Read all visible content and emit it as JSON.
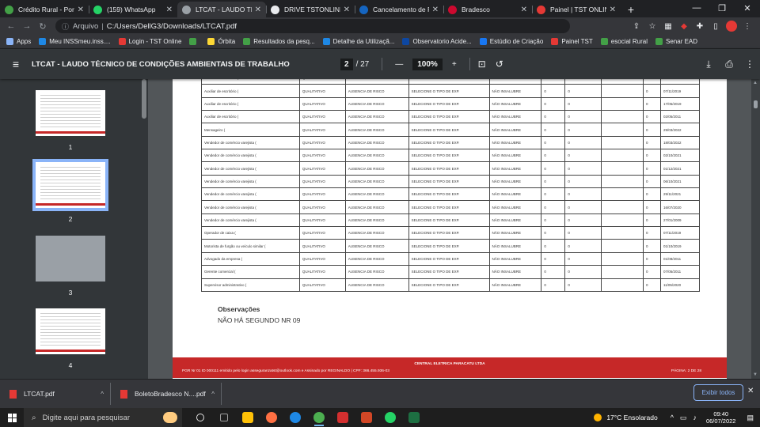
{
  "browser": {
    "tabs": [
      {
        "title": "Crédito Rural - Portal",
        "icon_color": "#43a047",
        "active": false
      },
      {
        "title": "(159) WhatsApp",
        "icon_color": "#25d366",
        "active": false
      },
      {
        "title": "LTCAT - LAUDO TÉCNICO",
        "icon_color": "#9aa0a6",
        "active": true
      },
      {
        "title": "DRIVE TSTONLINE",
        "icon_color": "#e8eaed",
        "active": false
      },
      {
        "title": "Cancelamento de Pro",
        "icon_color": "#1565c0",
        "active": false
      },
      {
        "title": "Bradesco",
        "icon_color": "#cc092f",
        "active": false
      },
      {
        "title": "Painel | TST ONLINE",
        "icon_color": "#e53935",
        "active": false
      }
    ],
    "new_tab_label": "+",
    "omnibox": {
      "scheme_label": "Arquivo",
      "url": "C:/Users/DellG3/Downloads/LTCAT.pdf"
    },
    "bookmarks": [
      {
        "label": "Apps",
        "color": "#8ab4f8"
      },
      {
        "label": "Meu INSSmeu.inss....",
        "color": "#1e88e5"
      },
      {
        "label": "Login - TST Online",
        "color": "#e53935"
      },
      {
        "label": "",
        "color": "#43a047"
      },
      {
        "label": "Órbita",
        "color": "#fdd835"
      },
      {
        "label": "Resultados da pesq...",
        "color": "#43a047"
      },
      {
        "label": "Detalhe da Utilizaçã...",
        "color": "#1e88e5"
      },
      {
        "label": "Observatorio Acide...",
        "color": "#0d47a1"
      },
      {
        "label": "Estúdio de Criação",
        "color": "#1877f2"
      },
      {
        "label": "Painel TST",
        "color": "#e53935"
      },
      {
        "label": "esocial Rural",
        "color": "#43a047"
      },
      {
        "label": "Senar EAD",
        "color": "#43a047"
      }
    ]
  },
  "pdf": {
    "title": "LTCAT - LAUDO TÉCNICO DE CONDIÇÕES AMBIENTAIS DE TRABALHO",
    "current_page": "2",
    "total_pages": "/ 27",
    "zoom": "100%",
    "thumbnails": [
      {
        "number": "1"
      },
      {
        "number": "2"
      },
      {
        "number": "3"
      },
      {
        "number": "4"
      }
    ],
    "table_rows": [
      [
        "Auxiliar de escritório (",
        "QUALITATIVO",
        "AUSENCIA DE RISCO",
        "SELECIONE O TIPO DE EXP.",
        "NÃO INSALUBRE",
        "0",
        "0",
        "",
        "0",
        "02/05/2022"
      ],
      [
        "Auxiliar de escritório (",
        "QUALITATIVO",
        "AUSENCIA DE RISCO",
        "SELECIONE O TIPO DE EXP.",
        "NÃO INSALUBRE",
        "0",
        "0",
        "",
        "0",
        "07/11/2019"
      ],
      [
        "Auxiliar de escritório (",
        "QUALITATIVO",
        "AUSENCIA DE RISCO",
        "SELECIONE O TIPO DE EXP.",
        "NÃO INSALUBRE",
        "0",
        "0",
        "",
        "0",
        "17/05/2019"
      ],
      [
        "Auxiliar de escritório (",
        "QUALITATIVO",
        "AUSENCIA DE RISCO",
        "SELECIONE O TIPO DE EXP.",
        "NÃO INSALUBRE",
        "0",
        "0",
        "",
        "0",
        "02/05/2011"
      ],
      [
        "Mensageiro (",
        "QUALITATIVO",
        "AUSENCIA DE RISCO",
        "SELECIONE O TIPO DE EXP.",
        "NÃO INSALUBRE",
        "0",
        "0",
        "",
        "0",
        "29/03/2022"
      ],
      [
        "Vendedor de comércio varejista (",
        "QUALITATIVO",
        "AUSENCIA DE RISCO",
        "SELECIONE O TIPO DE EXP.",
        "NÃO INSALUBRE",
        "0",
        "0",
        "",
        "0",
        "18/03/2022"
      ],
      [
        "Vendedor de comércio varejista (",
        "QUALITATIVO",
        "AUSENCIA DE RISCO",
        "SELECIONE O TIPO DE EXP.",
        "NÃO INSALUBRE",
        "0",
        "0",
        "",
        "0",
        "02/10/2021"
      ],
      [
        "Vendedor de comércio varejista (",
        "QUALITATIVO",
        "AUSENCIA DE RISCO",
        "SELECIONE O TIPO DE EXP.",
        "NÃO INSALUBRE",
        "0",
        "0",
        "",
        "0",
        "01/12/2021"
      ],
      [
        "Vendedor de comércio varejista (",
        "QUALITATIVO",
        "AUSENCIA DE RISCO",
        "SELECIONE O TIPO DE EXP.",
        "NÃO INSALUBRE",
        "0",
        "0",
        "",
        "0",
        "06/10/2021"
      ],
      [
        "Vendedor de comércio varejista (",
        "QUALITATIVO",
        "AUSENCIA DE RISCO",
        "SELECIONE O TIPO DE EXP.",
        "NÃO INSALUBRE",
        "0",
        "0",
        "",
        "0",
        "29/11/2021"
      ],
      [
        "Vendedor de comércio varejista (",
        "QUALITATIVO",
        "AUSENCIA DE RISCO",
        "SELECIONE O TIPO DE EXP.",
        "NÃO INSALUBRE",
        "0",
        "0",
        "",
        "0",
        "16/07/2020"
      ],
      [
        "Vendedor de comércio varejista (",
        "QUALITATIVO",
        "AUSENCIA DE RISCO",
        "SELECIONE O TIPO DE EXP.",
        "NÃO INSALUBRE",
        "0",
        "0",
        "",
        "0",
        "27/01/2009"
      ],
      [
        "Operador de caixa (",
        "QUALITATIVO",
        "AUSENCIA DE RISCO",
        "SELECIONE O TIPO DE EXP.",
        "NÃO INSALUBRE",
        "0",
        "0",
        "",
        "0",
        "07/11/2019"
      ],
      [
        "Motorista de furgão ou veículo similar (",
        "QUALITATIVO",
        "AUSENCIA DE RISCO",
        "SELECIONE O TIPO DE EXP.",
        "NÃO INSALUBRE",
        "0",
        "0",
        "",
        "0",
        "01/10/2019"
      ],
      [
        "Advogado da empresa (",
        "QUALITATIVO",
        "AUSENCIA DE RISCO",
        "SELECIONE O TIPO DE EXP.",
        "NÃO INSALUBRE",
        "0",
        "0",
        "",
        "0",
        "01/08/2011"
      ],
      [
        "Gerente comercial (",
        "QUALITATIVO",
        "AUSENCIA DE RISCO",
        "SELECIONE O TIPO DE EXP.",
        "NÃO INSALUBRE",
        "0",
        "0",
        "",
        "0",
        "07/05/2011"
      ],
      [
        "Supervisor administrativo (",
        "QUALITATIVO",
        "AUSENCIA DE RISCO",
        "SELECIONE O TIPO DE EXP.",
        "NÃO INSALUBRE",
        "0",
        "0",
        "",
        "0",
        "11/05/2020"
      ]
    ],
    "observations_title": "Observações",
    "observations_text": "NÃO HÁ SEGUNDO NR 09",
    "footer_company": "CENTRAL ELETRICA PARACATU LTDA",
    "footer_emitted": "PGR Nr 01 ID 000111 emitido pelo login asseguranzatst@outlook.com e Assinado por REGINALDO | CPF: 366.455.936-03",
    "footer_page": "PÁGINA: 2 DE 28"
  },
  "downloads": [
    {
      "filename": "LTCAT.pdf"
    },
    {
      "filename": "BoletoBradesco N....pdf"
    }
  ],
  "show_all_label": "Exibir todos",
  "taskbar": {
    "search_placeholder": "Digite aqui para pesquisar",
    "apps": [
      {
        "name": "task-view",
        "color": "#e0e0e0",
        "running": false
      },
      {
        "name": "widgets",
        "color": "#9e9e9e",
        "running": false
      },
      {
        "name": "file-explorer",
        "color": "#ffc107",
        "running": false
      },
      {
        "name": "firefox",
        "color": "#ff7043",
        "running": false
      },
      {
        "name": "edge",
        "color": "#1e88e5",
        "running": false
      },
      {
        "name": "chrome",
        "color": "#4caf50",
        "running": true
      },
      {
        "name": "acrobat",
        "color": "#d32f2f",
        "running": false
      },
      {
        "name": "powerpoint",
        "color": "#d24726",
        "running": false
      },
      {
        "name": "whatsapp",
        "color": "#25d366",
        "running": false
      },
      {
        "name": "excel",
        "color": "#1d6f42",
        "running": false
      }
    ],
    "weather": "17°C  Ensolarado",
    "time": "09:40",
    "date": "06/07/2022"
  }
}
